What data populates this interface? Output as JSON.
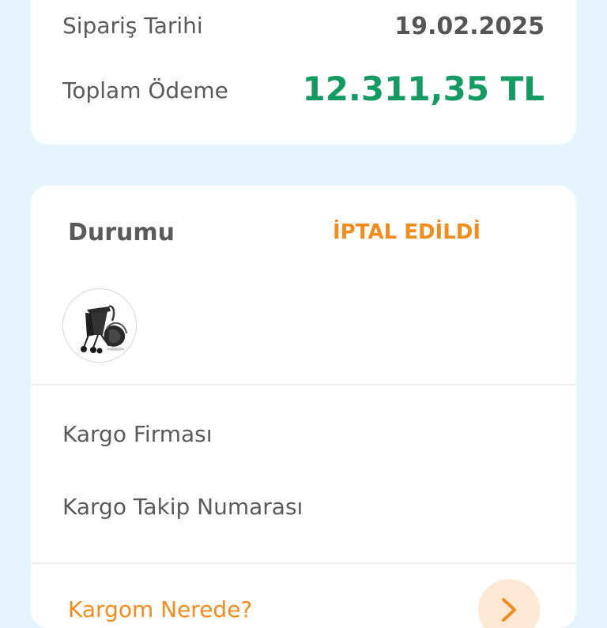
{
  "order_summary": {
    "date_label": "Sipariş Tarihi",
    "date_value": "19.02.2025",
    "total_label": "Toplam Ödeme",
    "total_value": "12.311,35 TL"
  },
  "status_card": {
    "status_label": "Durumu",
    "status_value": "İPTAL EDİLDİ",
    "product_image_icon": "stroller-with-car-seat-icon",
    "cargo_company_label": "Kargo Firması",
    "cargo_tracking_label": "Kargo Takip Numarası",
    "help_link_label": "Kargom Nerede?",
    "arrow_icon": "chevron-right-icon"
  },
  "colors": {
    "background": "#e6f4fd",
    "card": "#ffffff",
    "total_green": "#149b64",
    "status_orange": "#f28c1c",
    "arrow_bg": "#fde9d3"
  }
}
